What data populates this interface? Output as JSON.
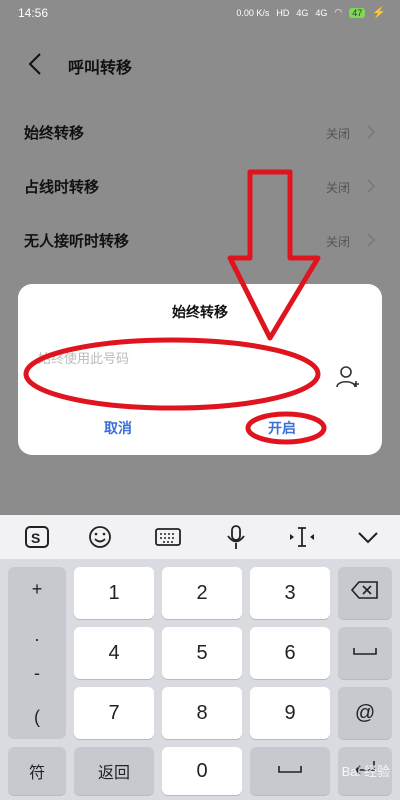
{
  "statusbar": {
    "time": "14:56",
    "net_speed": "0.00 K/s",
    "hd": "HD",
    "sig1": "4G",
    "sig2": "4G",
    "battery": "47"
  },
  "header": {
    "title": "呼叫转移",
    "back_icon": "chevron-left-icon"
  },
  "settings": [
    {
      "label": "始终转移",
      "value": "关闭"
    },
    {
      "label": "占线时转移",
      "value": "关闭"
    },
    {
      "label": "无人接听时转移",
      "value": "关闭"
    }
  ],
  "dialog": {
    "title": "始终转移",
    "input_placeholder": "始终使用此号码",
    "input_value": "",
    "contact_icon": "person-add-icon",
    "cancel_label": "取消",
    "enable_label": "开启"
  },
  "keyboard": {
    "toolbar_icons": [
      "sogou-logo-icon",
      "emoji-icon",
      "keyboard-icon",
      "microphone-icon",
      "cursor-icon",
      "chevron-down-icon"
    ],
    "side_keys": [
      "+",
      ".",
      "-",
      "("
    ],
    "digits": [
      "1",
      "2",
      "3",
      "4",
      "5",
      "6",
      "7",
      "8",
      "9",
      "0"
    ],
    "right_keys": {
      "backspace": "backspace-icon",
      "space": "space-icon",
      "at": "@",
      "enter": "enter-icon"
    },
    "bottom": {
      "symbols_label": "符",
      "back_label": "返回"
    }
  },
  "watermark": "Bai 经验",
  "colors": {
    "accent": "#3a6fd8",
    "annotation": "#e0141e",
    "overlay": "#8c8c8c"
  }
}
